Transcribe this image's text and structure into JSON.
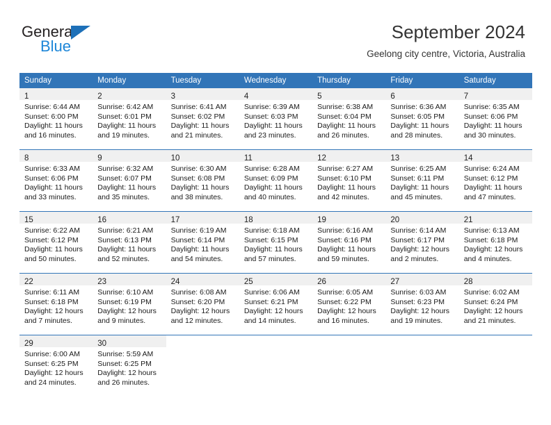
{
  "logo": {
    "word_top": "General",
    "word_bottom": "Blue",
    "triangle_color": "#1d70b8",
    "blue_text_color": "#1d86d8"
  },
  "header": {
    "title": "September 2024",
    "subtitle": "Geelong city centre, Victoria, Australia",
    "header_bg_color": "#3275b8"
  },
  "weekday_headers": [
    "Sunday",
    "Monday",
    "Tuesday",
    "Wednesday",
    "Thursday",
    "Friday",
    "Saturday"
  ],
  "labels": {
    "sunrise_prefix": "Sunrise:",
    "sunset_prefix": "Sunset:",
    "daylight_prefix": "Daylight:"
  },
  "weeks": [
    [
      {
        "day": "1",
        "sunrise": "Sunrise: 6:44 AM",
        "sunset": "Sunset: 6:00 PM",
        "daylight_l1": "Daylight: 11 hours",
        "daylight_l2": "and 16 minutes."
      },
      {
        "day": "2",
        "sunrise": "Sunrise: 6:42 AM",
        "sunset": "Sunset: 6:01 PM",
        "daylight_l1": "Daylight: 11 hours",
        "daylight_l2": "and 19 minutes."
      },
      {
        "day": "3",
        "sunrise": "Sunrise: 6:41 AM",
        "sunset": "Sunset: 6:02 PM",
        "daylight_l1": "Daylight: 11 hours",
        "daylight_l2": "and 21 minutes."
      },
      {
        "day": "4",
        "sunrise": "Sunrise: 6:39 AM",
        "sunset": "Sunset: 6:03 PM",
        "daylight_l1": "Daylight: 11 hours",
        "daylight_l2": "and 23 minutes."
      },
      {
        "day": "5",
        "sunrise": "Sunrise: 6:38 AM",
        "sunset": "Sunset: 6:04 PM",
        "daylight_l1": "Daylight: 11 hours",
        "daylight_l2": "and 26 minutes."
      },
      {
        "day": "6",
        "sunrise": "Sunrise: 6:36 AM",
        "sunset": "Sunset: 6:05 PM",
        "daylight_l1": "Daylight: 11 hours",
        "daylight_l2": "and 28 minutes."
      },
      {
        "day": "7",
        "sunrise": "Sunrise: 6:35 AM",
        "sunset": "Sunset: 6:06 PM",
        "daylight_l1": "Daylight: 11 hours",
        "daylight_l2": "and 30 minutes."
      }
    ],
    [
      {
        "day": "8",
        "sunrise": "Sunrise: 6:33 AM",
        "sunset": "Sunset: 6:06 PM",
        "daylight_l1": "Daylight: 11 hours",
        "daylight_l2": "and 33 minutes."
      },
      {
        "day": "9",
        "sunrise": "Sunrise: 6:32 AM",
        "sunset": "Sunset: 6:07 PM",
        "daylight_l1": "Daylight: 11 hours",
        "daylight_l2": "and 35 minutes."
      },
      {
        "day": "10",
        "sunrise": "Sunrise: 6:30 AM",
        "sunset": "Sunset: 6:08 PM",
        "daylight_l1": "Daylight: 11 hours",
        "daylight_l2": "and 38 minutes."
      },
      {
        "day": "11",
        "sunrise": "Sunrise: 6:28 AM",
        "sunset": "Sunset: 6:09 PM",
        "daylight_l1": "Daylight: 11 hours",
        "daylight_l2": "and 40 minutes."
      },
      {
        "day": "12",
        "sunrise": "Sunrise: 6:27 AM",
        "sunset": "Sunset: 6:10 PM",
        "daylight_l1": "Daylight: 11 hours",
        "daylight_l2": "and 42 minutes."
      },
      {
        "day": "13",
        "sunrise": "Sunrise: 6:25 AM",
        "sunset": "Sunset: 6:11 PM",
        "daylight_l1": "Daylight: 11 hours",
        "daylight_l2": "and 45 minutes."
      },
      {
        "day": "14",
        "sunrise": "Sunrise: 6:24 AM",
        "sunset": "Sunset: 6:12 PM",
        "daylight_l1": "Daylight: 11 hours",
        "daylight_l2": "and 47 minutes."
      }
    ],
    [
      {
        "day": "15",
        "sunrise": "Sunrise: 6:22 AM",
        "sunset": "Sunset: 6:12 PM",
        "daylight_l1": "Daylight: 11 hours",
        "daylight_l2": "and 50 minutes."
      },
      {
        "day": "16",
        "sunrise": "Sunrise: 6:21 AM",
        "sunset": "Sunset: 6:13 PM",
        "daylight_l1": "Daylight: 11 hours",
        "daylight_l2": "and 52 minutes."
      },
      {
        "day": "17",
        "sunrise": "Sunrise: 6:19 AM",
        "sunset": "Sunset: 6:14 PM",
        "daylight_l1": "Daylight: 11 hours",
        "daylight_l2": "and 54 minutes."
      },
      {
        "day": "18",
        "sunrise": "Sunrise: 6:18 AM",
        "sunset": "Sunset: 6:15 PM",
        "daylight_l1": "Daylight: 11 hours",
        "daylight_l2": "and 57 minutes."
      },
      {
        "day": "19",
        "sunrise": "Sunrise: 6:16 AM",
        "sunset": "Sunset: 6:16 PM",
        "daylight_l1": "Daylight: 11 hours",
        "daylight_l2": "and 59 minutes."
      },
      {
        "day": "20",
        "sunrise": "Sunrise: 6:14 AM",
        "sunset": "Sunset: 6:17 PM",
        "daylight_l1": "Daylight: 12 hours",
        "daylight_l2": "and 2 minutes."
      },
      {
        "day": "21",
        "sunrise": "Sunrise: 6:13 AM",
        "sunset": "Sunset: 6:18 PM",
        "daylight_l1": "Daylight: 12 hours",
        "daylight_l2": "and 4 minutes."
      }
    ],
    [
      {
        "day": "22",
        "sunrise": "Sunrise: 6:11 AM",
        "sunset": "Sunset: 6:18 PM",
        "daylight_l1": "Daylight: 12 hours",
        "daylight_l2": "and 7 minutes."
      },
      {
        "day": "23",
        "sunrise": "Sunrise: 6:10 AM",
        "sunset": "Sunset: 6:19 PM",
        "daylight_l1": "Daylight: 12 hours",
        "daylight_l2": "and 9 minutes."
      },
      {
        "day": "24",
        "sunrise": "Sunrise: 6:08 AM",
        "sunset": "Sunset: 6:20 PM",
        "daylight_l1": "Daylight: 12 hours",
        "daylight_l2": "and 12 minutes."
      },
      {
        "day": "25",
        "sunrise": "Sunrise: 6:06 AM",
        "sunset": "Sunset: 6:21 PM",
        "daylight_l1": "Daylight: 12 hours",
        "daylight_l2": "and 14 minutes."
      },
      {
        "day": "26",
        "sunrise": "Sunrise: 6:05 AM",
        "sunset": "Sunset: 6:22 PM",
        "daylight_l1": "Daylight: 12 hours",
        "daylight_l2": "and 16 minutes."
      },
      {
        "day": "27",
        "sunrise": "Sunrise: 6:03 AM",
        "sunset": "Sunset: 6:23 PM",
        "daylight_l1": "Daylight: 12 hours",
        "daylight_l2": "and 19 minutes."
      },
      {
        "day": "28",
        "sunrise": "Sunrise: 6:02 AM",
        "sunset": "Sunset: 6:24 PM",
        "daylight_l1": "Daylight: 12 hours",
        "daylight_l2": "and 21 minutes."
      }
    ],
    [
      {
        "day": "29",
        "sunrise": "Sunrise: 6:00 AM",
        "sunset": "Sunset: 6:25 PM",
        "daylight_l1": "Daylight: 12 hours",
        "daylight_l2": "and 24 minutes."
      },
      {
        "day": "30",
        "sunrise": "Sunrise: 5:59 AM",
        "sunset": "Sunset: 6:25 PM",
        "daylight_l1": "Daylight: 12 hours",
        "daylight_l2": "and 26 minutes."
      },
      {
        "day": "",
        "sunrise": "",
        "sunset": "",
        "daylight_l1": "",
        "daylight_l2": ""
      },
      {
        "day": "",
        "sunrise": "",
        "sunset": "",
        "daylight_l1": "",
        "daylight_l2": ""
      },
      {
        "day": "",
        "sunrise": "",
        "sunset": "",
        "daylight_l1": "",
        "daylight_l2": ""
      },
      {
        "day": "",
        "sunrise": "",
        "sunset": "",
        "daylight_l1": "",
        "daylight_l2": ""
      },
      {
        "day": "",
        "sunrise": "",
        "sunset": "",
        "daylight_l1": "",
        "daylight_l2": ""
      }
    ]
  ]
}
